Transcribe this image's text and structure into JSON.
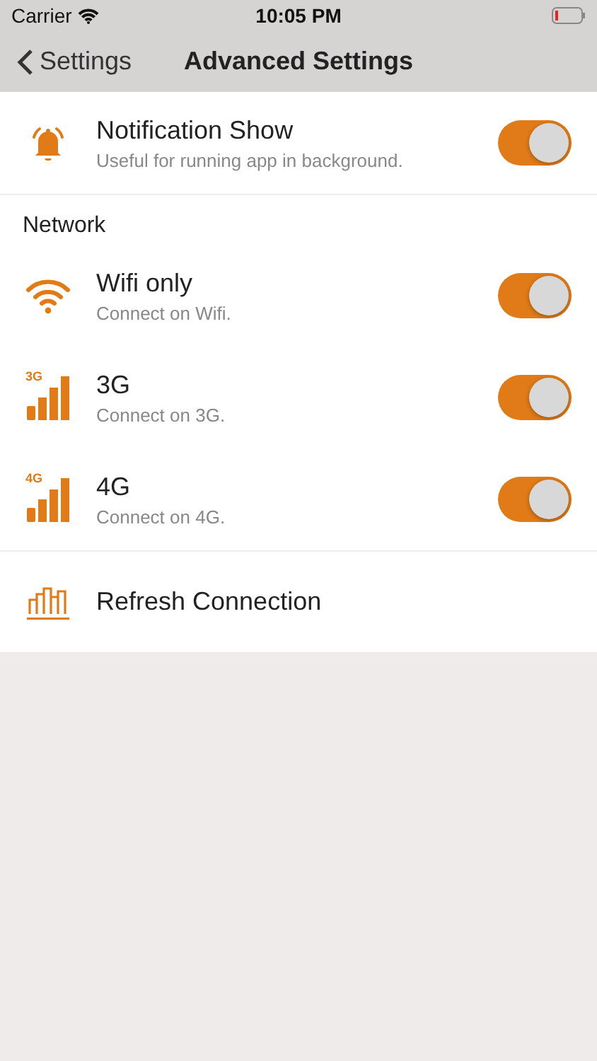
{
  "status_bar": {
    "carrier": "Carrier",
    "time": "10:05 PM"
  },
  "nav": {
    "back": "Settings",
    "title": "Advanced Settings"
  },
  "top_rows": [
    {
      "kind": "alert",
      "title": "Notification Show",
      "subtitle": "Useful for running app in background.",
      "on": true
    }
  ],
  "network": {
    "header": "Network",
    "rows": [
      {
        "kind": "wifi",
        "title": "Wifi only",
        "subtitle": "Connect on Wifi.",
        "on": true
      },
      {
        "kind": "cellular",
        "badge": "3G",
        "title": "3G",
        "subtitle": "Connect on 3G.",
        "on": true
      },
      {
        "kind": "cellular",
        "badge": "4G",
        "title": "4G",
        "subtitle": "Connect on 4G.",
        "on": true
      },
      {
        "kind": "action",
        "title": "Refresh Connection"
      }
    ]
  }
}
